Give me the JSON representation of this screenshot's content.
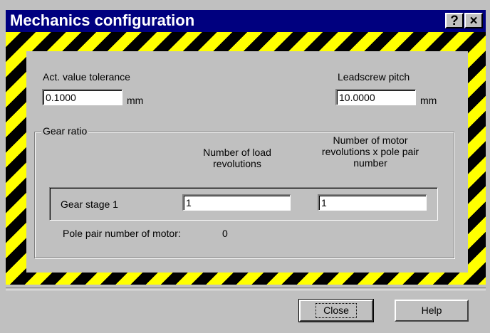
{
  "window": {
    "title": "Mechanics configuration"
  },
  "title_buttons": {
    "help": "?",
    "close": "×"
  },
  "tolerance": {
    "label": "Act. value tolerance",
    "value": "0.1000",
    "unit": "mm"
  },
  "leadscrew": {
    "label": "Leadscrew pitch",
    "value": "10.0000",
    "unit": "mm"
  },
  "gear_ratio": {
    "group_title": "Gear ratio",
    "load_header": "Number of load revolutions",
    "motor_header": "Number of motor revolutions x pole pair number",
    "stage_label": "Gear stage 1",
    "load_value": "1",
    "motor_value": "1",
    "pole_pair_label": "Pole pair number of motor:",
    "pole_pair_value": "0"
  },
  "buttons": {
    "close": "Close",
    "help": "Help"
  },
  "colors": {
    "titlebar": "#00007f",
    "hazard_yellow": "#ffff00",
    "hazard_black": "#000000",
    "face": "#c0c0c0"
  }
}
